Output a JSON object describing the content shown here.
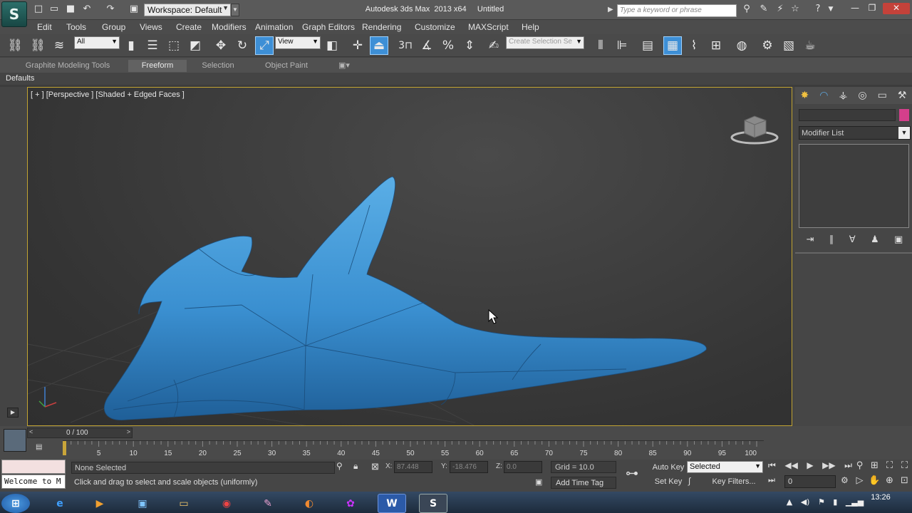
{
  "title_bar": {
    "app_title": "Autodesk 3ds Max  2013 x64     Untitled",
    "workspace_label": "Workspace: Default",
    "search_placeholder": "Type a keyword or phrase",
    "logo_glyph": "S"
  },
  "menu": [
    "Edit",
    "Tools",
    "Group",
    "Views",
    "Create",
    "Modifiers",
    "Animation",
    "Graph Editors",
    "Rendering",
    "Customize",
    "MAXScript",
    "Help"
  ],
  "toolbar": {
    "selection_filter": "All",
    "reference_coord": "View",
    "named_selection_placeholder": "Create Selection Se",
    "snap_label": "3"
  },
  "ribbon": {
    "tabs": [
      "Graphite Modeling Tools",
      "Freeform",
      "Selection",
      "Object Paint"
    ],
    "active_tab": "Freeform",
    "sub_label": "Defaults"
  },
  "viewport": {
    "label": "[ + ] [Perspective ] [Shaded + Edged Faces ]",
    "object_color": "#3a8fd0"
  },
  "command_panel": {
    "modifier_list": "Modifier List",
    "color_swatch": "#d43f8b"
  },
  "timeline": {
    "frame_counter": "0 / 100",
    "ticks": [
      5,
      10,
      15,
      20,
      25,
      30,
      35,
      40,
      45,
      50,
      55,
      60,
      65,
      70,
      75,
      80,
      85,
      90,
      95,
      100
    ]
  },
  "status": {
    "maxscript_text": "Welcome to M",
    "selection_status": "None Selected",
    "prompt": "Click and drag to select and scale objects (uniformly)",
    "x_label": "X:",
    "x_value": "87.448",
    "y_label": "Y:",
    "y_value": "-18.476",
    "z_label": "Z:",
    "z_value": "0.0",
    "grid": "Grid = 10.0",
    "add_time_tag": "Add Time Tag",
    "auto_key": "Auto Key",
    "set_key": "Set Key",
    "key_mode": "Selected",
    "key_filters": "Key Filters...",
    "current_frame": "0"
  },
  "taskbar": {
    "clock_time": "13:26",
    "apps": [
      "start",
      "ie",
      "media",
      "explorer",
      "chrome",
      "paint",
      "firefox",
      "picasa",
      "word",
      "3dsmax"
    ]
  }
}
